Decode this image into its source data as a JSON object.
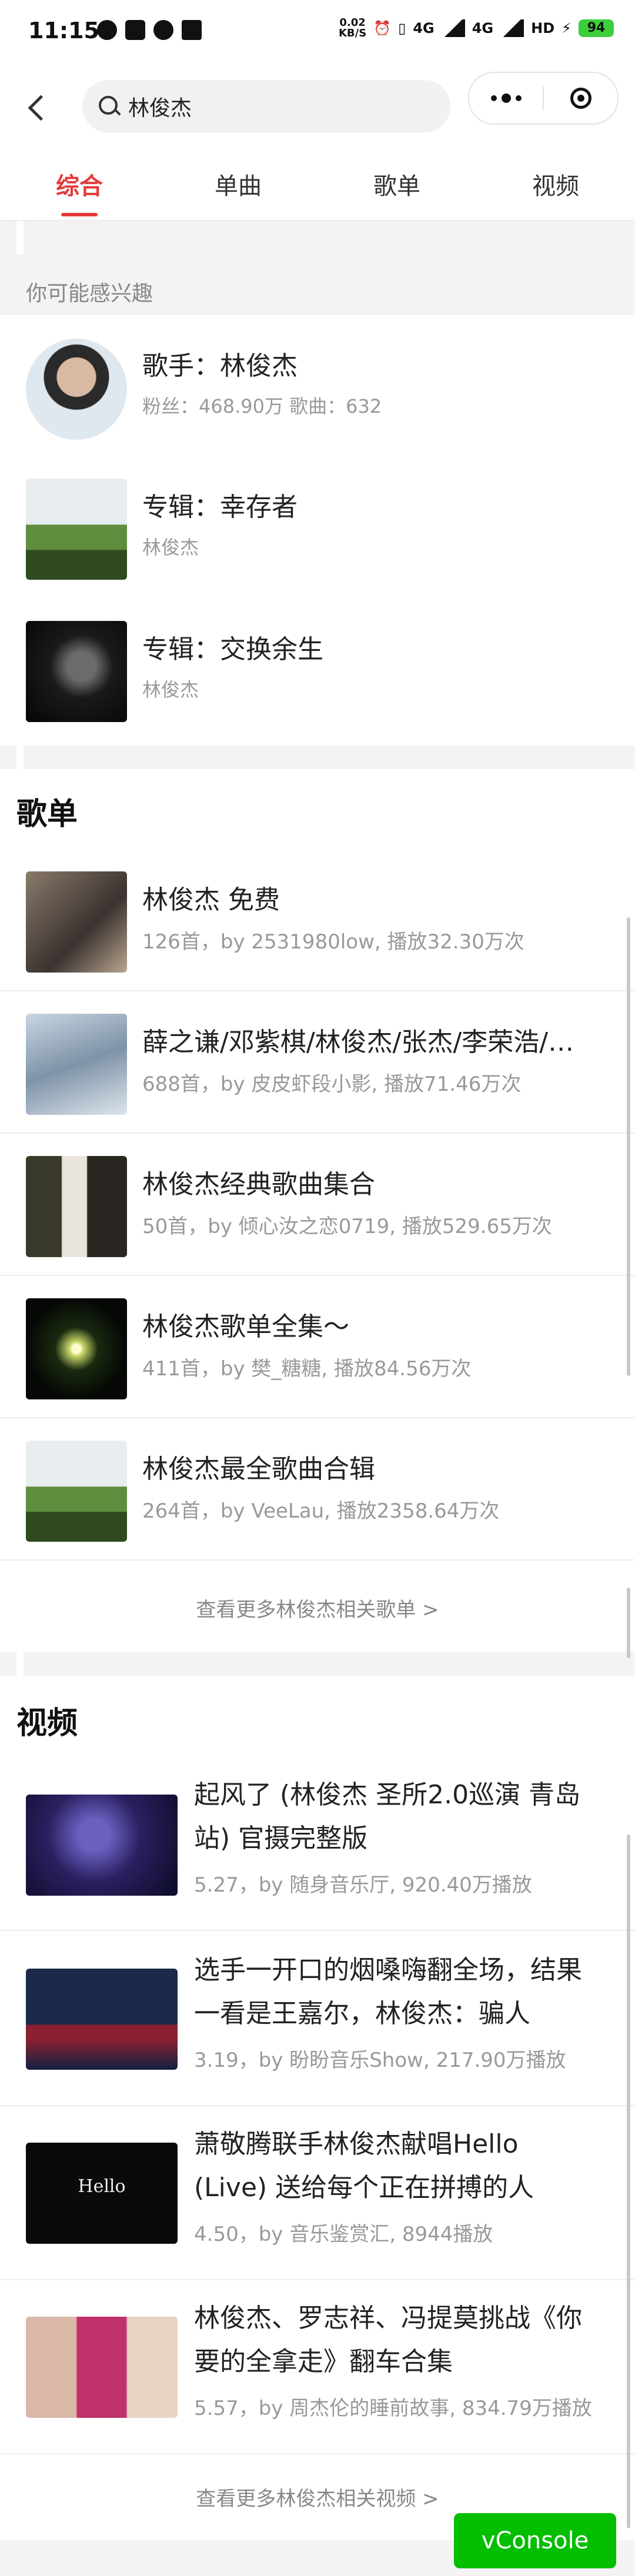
{
  "status_bar": {
    "time": "11:15",
    "net_speed_value": "0.02",
    "net_speed_unit": "KB/S",
    "signal1": "4G",
    "signal2": "4G",
    "signal3": "HD",
    "battery": "94"
  },
  "search": {
    "query": "林俊杰"
  },
  "tabs": [
    {
      "label": "综合"
    },
    {
      "label": "单曲"
    },
    {
      "label": "歌单"
    },
    {
      "label": "视频"
    }
  ],
  "suggest": {
    "title": "你可能感兴趣",
    "items": [
      {
        "title": "歌手：林俊杰",
        "sub": "粉丝：468.90万 歌曲：632"
      },
      {
        "title": "专辑：幸存者",
        "sub": "林俊杰"
      },
      {
        "title": "专辑：交换余生",
        "sub": "林俊杰"
      }
    ]
  },
  "playlists": {
    "title": "歌单",
    "items": [
      {
        "title": "林俊杰 免费",
        "meta": "126首，by 2531980low, 播放32.30万次"
      },
      {
        "title": "薛之谦/邓紫棋/林俊杰/张杰/李荣浩/…",
        "meta": "688首，by 皮皮虾段小影, 播放71.46万次"
      },
      {
        "title": "林俊杰经典歌曲集合",
        "meta": "50首，by 倾心汝之恋0719, 播放529.65万次"
      },
      {
        "title": "林俊杰歌单全集～",
        "meta": "411首，by 樊_糖糖, 播放84.56万次"
      },
      {
        "title": "林俊杰最全歌曲合辑",
        "meta": "264首，by VeeLau, 播放2358.64万次"
      }
    ],
    "more": "查看更多林俊杰相关歌单 >"
  },
  "videos": {
    "title": "视频",
    "items": [
      {
        "title": "起风了 (林俊杰 圣所2.0巡演 青岛站) 官摄完整版",
        "meta": "5.27，by 随身音乐厅, 920.40万播放",
        "thumb_text": ""
      },
      {
        "title": "选手一开口的烟嗓嗨翻全场，结果一看是王嘉尔，林俊杰：骗人",
        "meta": "3.19，by 盼盼音乐Show, 217.90万播放",
        "thumb_text": ""
      },
      {
        "title": "萧敬腾联手林俊杰献唱Hello (Live) 送给每个正在拼搏的人",
        "meta": "4.50，by 音乐鉴赏汇, 8944播放",
        "thumb_text": "Hello"
      },
      {
        "title": "林俊杰、罗志祥、冯提莫挑战《你要的全拿走》翻车合集",
        "meta": "5.57，by 周杰伦的睡前故事, 834.79万播放",
        "thumb_text": ""
      }
    ],
    "more": "查看更多林俊杰相关视频 >"
  },
  "vconsole": {
    "label": "vConsole"
  },
  "colors": {
    "accent": "#e33b3b",
    "vconsole": "#04be02"
  }
}
